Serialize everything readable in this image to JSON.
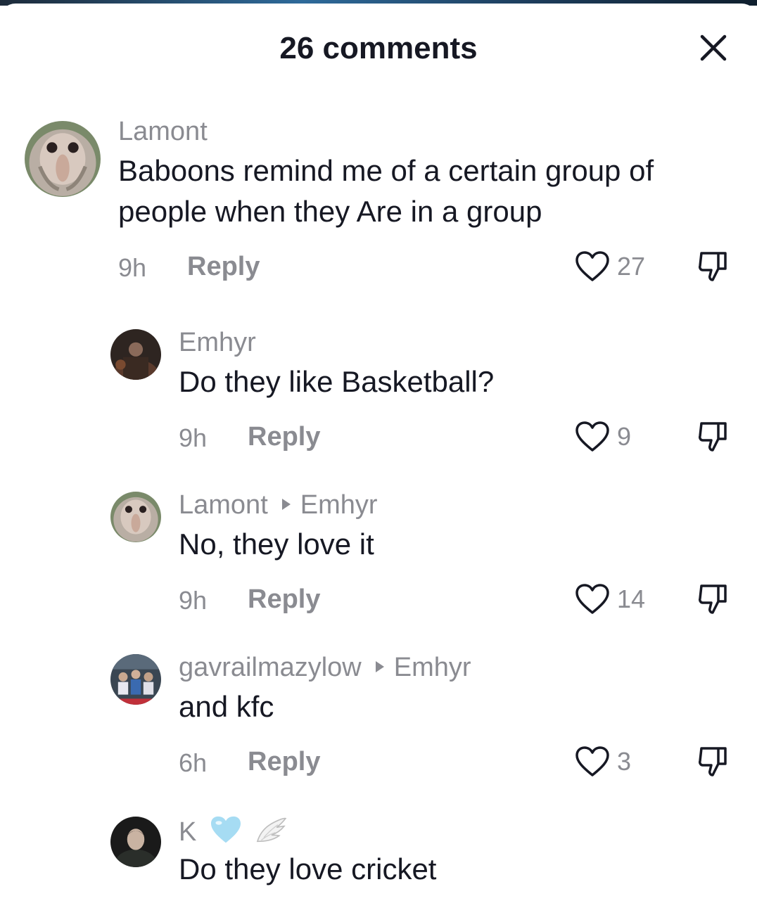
{
  "header": {
    "title": "26 comments"
  },
  "colors": {
    "text": "#161823",
    "muted": "#8a8b91",
    "heart": "#c6e9f7"
  },
  "comments": [
    {
      "user": "Lamont",
      "reply_to": "",
      "text": "Baboons remind me of a certain group of people when they Are in a group",
      "time": "9h",
      "reply_label": "Reply",
      "likes": "27",
      "avatar": "baboon-avatar"
    },
    {
      "user": "Emhyr",
      "reply_to": "",
      "text": "Do they like Basketball?",
      "time": "9h",
      "reply_label": "Reply",
      "likes": "9",
      "avatar": "dark-figure-avatar"
    },
    {
      "user": "Lamont",
      "reply_to": "Emhyr",
      "text": "No, they love it",
      "time": "9h",
      "reply_label": "Reply",
      "likes": "14",
      "avatar": "baboon-avatar"
    },
    {
      "user": "gavrailmazylow",
      "reply_to": "Emhyr",
      "text": "and kfc",
      "time": "6h",
      "reply_label": "Reply",
      "likes": "3",
      "avatar": "crowd-avatar"
    },
    {
      "user": "K",
      "reply_to": "",
      "emojis": [
        "light-blue-heart-icon",
        "angel-wings-icon"
      ],
      "text": "Do they love cricket",
      "avatar": "man-portrait-avatar"
    }
  ]
}
